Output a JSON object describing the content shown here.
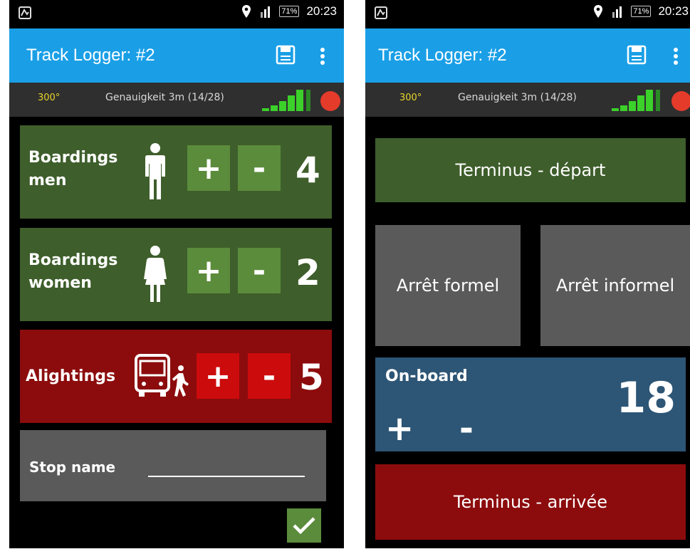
{
  "status_bar": {
    "clock": "20:23",
    "battery": "71%"
  },
  "left": {
    "app_title": "Track Logger: #2",
    "gps": {
      "heading": "300°",
      "accuracy": "Genauigkeit 3m (14/28)"
    },
    "boardings_men": {
      "label_line1": "Boardings",
      "label_line2": "men",
      "plus": "+",
      "minus": "-",
      "count": "4"
    },
    "boardings_women": {
      "label_line1": "Boardings",
      "label_line2": "women",
      "plus": "+",
      "minus": "-",
      "count": "2"
    },
    "alightings": {
      "label": "Alightings",
      "plus": "+",
      "minus": "-",
      "count": "5"
    },
    "stop_name_label": "Stop name"
  },
  "right": {
    "app_title": "Track Logger: #2",
    "gps": {
      "heading": "300°",
      "accuracy": "Genauigkeit 3m (14/28)"
    },
    "terminus_depart": "Terminus - départ",
    "arret_formel": "Arrêt formel",
    "arret_informel": "Arrêt informel",
    "onboard": {
      "label": "On-board",
      "plus": "+",
      "minus": "-",
      "count": "18"
    },
    "terminus_arrivee": "Terminus - arrivée"
  },
  "colors": {
    "app_bar": "#1a9fe6",
    "green_panel": "#3e5e2b",
    "green_button": "#5b8c3c",
    "red_panel": "#8c0c0d",
    "red_button": "#cc0b0d",
    "grey_panel": "#5a5a5a",
    "blue_panel": "#2d5575",
    "heading_text": "#e8d52a"
  }
}
